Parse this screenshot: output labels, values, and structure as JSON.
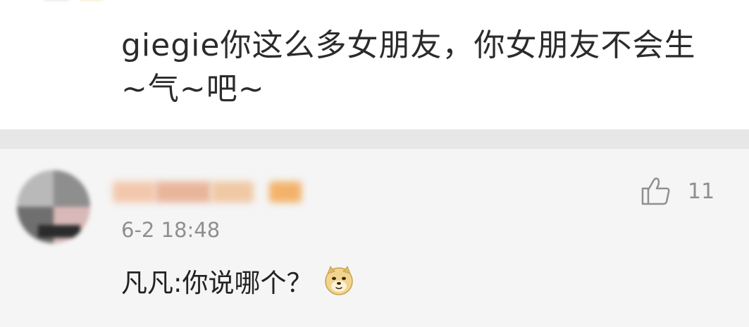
{
  "reply": {
    "text": "giegie你这么多女朋友，你女朋友不会生\n~气~吧~"
  },
  "comment": {
    "timestamp": "6-2 18:48",
    "like_count": "11",
    "text": "凡凡:你说哪个？",
    "emoji_icon": "doge-emoji-icon",
    "like_icon": "thumbs-up-icon"
  },
  "colors": {
    "page_bg": "#ffffff",
    "separator": "#e7e7e7",
    "comment_bg": "#f5f5f5",
    "meta_text": "#8f8f8f",
    "body_text": "#222222"
  }
}
